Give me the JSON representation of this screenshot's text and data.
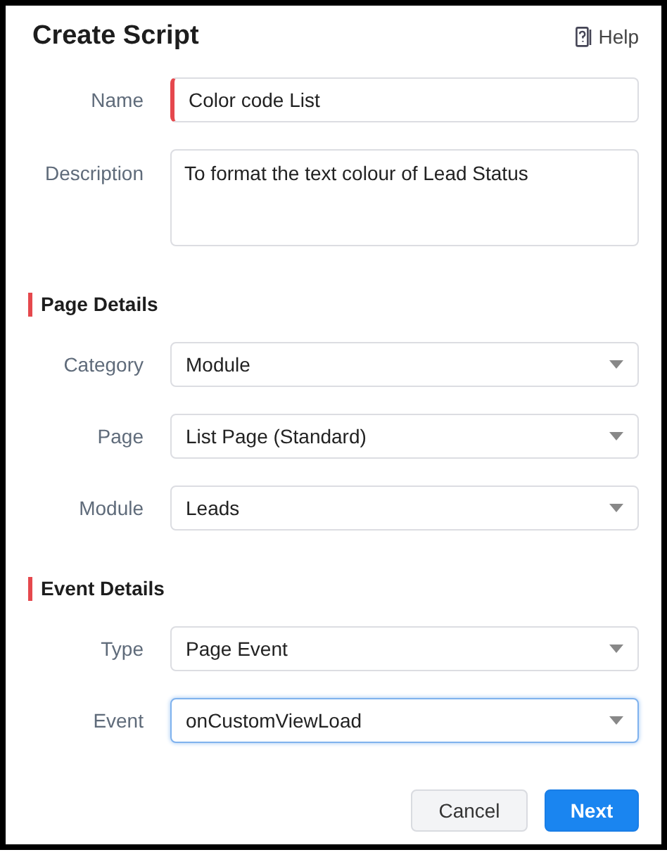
{
  "title": "Create Script",
  "help": {
    "label": "Help"
  },
  "fields": [
    {
      "kind": "text",
      "label": "Name",
      "value": "Color code List",
      "required": true,
      "focused": false
    },
    {
      "kind": "textarea",
      "label": "Description",
      "value": "To format the text colour of Lead Status",
      "required": false,
      "focused": false
    }
  ],
  "sections": [
    {
      "heading": "Page Details",
      "fields": [
        {
          "kind": "select",
          "label": "Category",
          "value": "Module",
          "required": false,
          "focused": false
        },
        {
          "kind": "select",
          "label": "Page",
          "value": "List Page (Standard)",
          "required": false,
          "focused": false
        },
        {
          "kind": "select",
          "label": "Module",
          "value": "Leads",
          "required": false,
          "focused": false
        }
      ]
    },
    {
      "heading": "Event Details",
      "fields": [
        {
          "kind": "select",
          "label": "Type",
          "value": "Page Event",
          "required": false,
          "focused": false
        },
        {
          "kind": "select",
          "label": "Event",
          "value": "onCustomViewLoad",
          "required": false,
          "focused": true
        }
      ]
    }
  ],
  "buttons": [
    {
      "label": "Cancel",
      "kind": "secondary"
    },
    {
      "label": "Next",
      "kind": "primary"
    }
  ]
}
